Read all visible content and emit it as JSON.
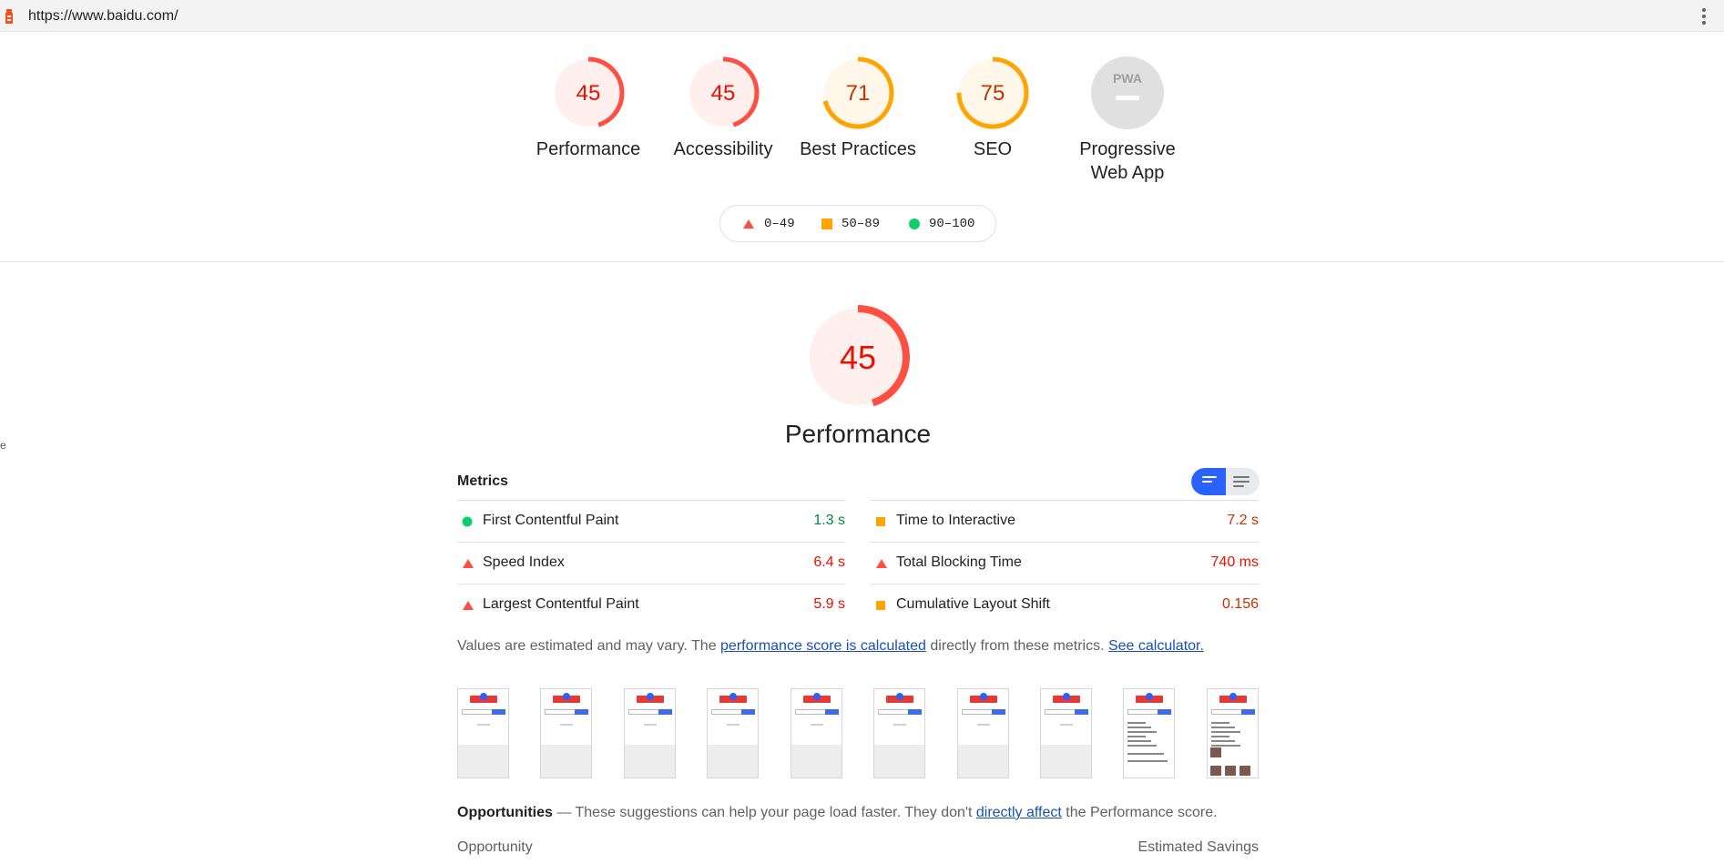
{
  "browser": {
    "url": "https://www.baidu.com/"
  },
  "gauges": [
    {
      "score": 45,
      "label": "Performance",
      "color": "#ff4e42",
      "bg": "#fff0ee"
    },
    {
      "score": 45,
      "label": "Accessibility",
      "color": "#ff4e42",
      "bg": "#fff0ee"
    },
    {
      "score": 71,
      "label": "Best Practices",
      "color": "#ffa400",
      "bg": "#fff8ea"
    },
    {
      "score": 75,
      "label": "SEO",
      "color": "#ffa400",
      "bg": "#fff8ea"
    }
  ],
  "pwa": {
    "badge": "PWA",
    "label_line1": "Progressive",
    "label_line2": "Web App"
  },
  "legend": {
    "fail": "0–49",
    "average": "50–89",
    "pass": "90–100"
  },
  "side_mark": "e",
  "performance": {
    "score": 45,
    "title": "Performance"
  },
  "metrics": {
    "heading": "Metrics",
    "left": [
      {
        "name": "First Contentful Paint",
        "value": "1.3 s",
        "rating": "pass"
      },
      {
        "name": "Speed Index",
        "value": "6.4 s",
        "rating": "fail"
      },
      {
        "name": "Largest Contentful Paint",
        "value": "5.9 s",
        "rating": "fail"
      }
    ],
    "right": [
      {
        "name": "Time to Interactive",
        "value": "7.2 s",
        "rating": "average"
      },
      {
        "name": "Total Blocking Time",
        "value": "740 ms",
        "rating": "fail"
      },
      {
        "name": "Cumulative Layout Shift",
        "value": "0.156",
        "rating": "average"
      }
    ]
  },
  "note": {
    "prefix": "Values are estimated and may vary. The ",
    "link1": "performance score is calculated",
    "middle": " directly from these metrics. ",
    "link2": "See calculator."
  },
  "opportunities": {
    "title": "Opportunities",
    "text": " — These suggestions can help your page load faster. They don't ",
    "link": "directly affect",
    "suffix": " the Performance score.",
    "col_left": "Opportunity",
    "col_right": "Estimated Savings"
  },
  "colors": {
    "fail": "#ff4e42",
    "fail_text": "#eb0f00",
    "average": "#ffa400",
    "average_text": "#c33300",
    "pass": "#0cce6b",
    "pass_text": "#018642",
    "toggle_active": "#2962ff"
  }
}
